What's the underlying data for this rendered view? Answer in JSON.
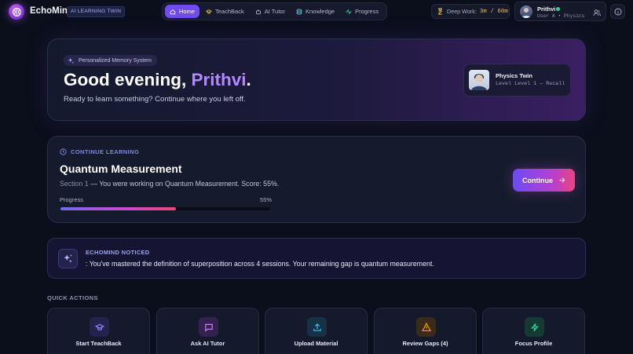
{
  "brand": {
    "name": "EchoMind",
    "badge": "AI LEARNING TWIN"
  },
  "nav": [
    {
      "label": "Home",
      "icon": "home-icon",
      "active": true
    },
    {
      "label": "TeachBack",
      "icon": "graduation-cap-icon",
      "active": false
    },
    {
      "label": "AI Tutor",
      "icon": "robot-icon",
      "active": false
    },
    {
      "label": "Knowledge",
      "icon": "database-icon",
      "active": false
    },
    {
      "label": "Progress",
      "icon": "activity-icon",
      "active": false
    }
  ],
  "deep_work": {
    "label": "Deep Work:",
    "value": "3m / 60m"
  },
  "user": {
    "name": "Prithvi",
    "subtitle": "User A • Physics"
  },
  "hero": {
    "pill": "Personalized Memory System",
    "greeting": "Good evening, ",
    "name": "Prithvi",
    "period": ".",
    "subtitle": "Ready to learn something? Continue where you left off.",
    "twin_title": "Physics Twin",
    "twin_subtitle": "Level Level 1 — Recall"
  },
  "continue": {
    "label": "CONTINUE LEARNING",
    "title": "Quantum Measurement",
    "section": "Section 1",
    "dash": " — ",
    "description": "You were working on Quantum Measurement. Score: 55%.",
    "progress_label": "Progress",
    "progress_text": "55%",
    "progress_fraction": 0.55,
    "button": "Continue"
  },
  "noticed": {
    "label": "ECHOMIND NOTICED",
    "text": ": You've mastered the definition of superposition across 4 sessions. Your remaining gap is quantum measurement."
  },
  "quick_actions": {
    "label": "QUICK ACTIONS",
    "items": [
      {
        "label": "Start TeachBack",
        "icon": "graduation-cap-icon",
        "color": "#7c6cf5"
      },
      {
        "label": "Ask AI Tutor",
        "icon": "chat-icon",
        "color": "#c77dff"
      },
      {
        "label": "Upload Material",
        "icon": "upload-icon",
        "color": "#38bdf8"
      },
      {
        "label": "Review Gaps (4)",
        "icon": "warning-icon",
        "color": "#f59e0b"
      },
      {
        "label": "Focus Profile",
        "icon": "lightning-icon",
        "color": "#34d399"
      }
    ]
  }
}
